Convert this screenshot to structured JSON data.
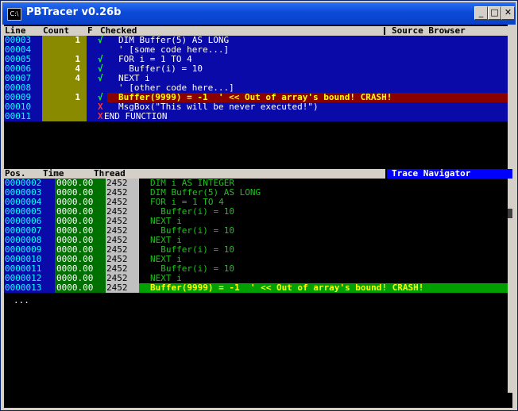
{
  "window": {
    "title": "PBTracer v0.26b",
    "icon_label": "C:\\",
    "controls": {
      "minimize": "_",
      "maximize": "□",
      "close": "✕"
    }
  },
  "colors": {
    "code_bg": "#0a0aa8",
    "count_bg": "#8a8a00",
    "line_fg": "#00ffff",
    "code_fg": "#ffffff",
    "check_ok": "#00ff00",
    "check_fail": "#ff3030",
    "crash_bg": "#8a0000",
    "crash_fg": "#ffff00",
    "trace_fg": "#20c020",
    "trace_hl_bg": "#00a000",
    "trace_hl_fg": "#ffff00"
  },
  "source": {
    "headers": {
      "line": "Line",
      "count": "Count",
      "flag": "F",
      "checked": "Checked"
    },
    "browser_title": "Source Browser",
    "rows": [
      {
        "line": "00003",
        "count": "1",
        "mark": "√",
        "code": "DIM Buffer(5) AS LONG"
      },
      {
        "line": "00004",
        "count": "",
        "mark": "",
        "code": "' [some code here...]"
      },
      {
        "line": "00005",
        "count": "1",
        "mark": "√",
        "code": "FOR i = 1 TO 4"
      },
      {
        "line": "00006",
        "count": "4",
        "mark": "√",
        "code": "  Buffer(i) = 10"
      },
      {
        "line": "00007",
        "count": "4",
        "mark": "√",
        "code": "NEXT i"
      },
      {
        "line": "00008",
        "count": "",
        "mark": "",
        "code": "' [other code here...]"
      },
      {
        "line": "00009",
        "count": "1",
        "mark": "√",
        "code": "Buffer(9999) = -1  ' << Out of array's bound! CRASH!"
      },
      {
        "line": "00010",
        "count": "",
        "mark": "X",
        "code": "MsgBox(\"This will be never executed!\")"
      },
      {
        "line": "00011",
        "count": "",
        "mark": "X",
        "code": "END FUNCTION"
      }
    ]
  },
  "trace": {
    "headers": {
      "pos": "Pos.",
      "time": "Time",
      "thread": "Thread"
    },
    "navigator_title": "Trace Navigator",
    "rows": [
      {
        "pos": "0000002",
        "time": "0000.00",
        "thread": "2452",
        "code": "DIM i AS INTEGER"
      },
      {
        "pos": "0000003",
        "time": "0000.00",
        "thread": "2452",
        "code": "DIM Buffer(5) AS LONG"
      },
      {
        "pos": "0000004",
        "time": "0000.00",
        "thread": "2452",
        "code": "FOR i = 1 TO 4"
      },
      {
        "pos": "0000005",
        "time": "0000.00",
        "thread": "2452",
        "code": "  Buffer(i) = 10"
      },
      {
        "pos": "0000006",
        "time": "0000.00",
        "thread": "2452",
        "code": "NEXT i"
      },
      {
        "pos": "0000007",
        "time": "0000.00",
        "thread": "2452",
        "code": "  Buffer(i) = 10"
      },
      {
        "pos": "0000008",
        "time": "0000.00",
        "thread": "2452",
        "code": "NEXT i"
      },
      {
        "pos": "0000009",
        "time": "0000.00",
        "thread": "2452",
        "code": "  Buffer(i) = 10"
      },
      {
        "pos": "0000010",
        "time": "0000.00",
        "thread": "2452",
        "code": "NEXT i"
      },
      {
        "pos": "0000011",
        "time": "0000.00",
        "thread": "2452",
        "code": "  Buffer(i) = 10"
      },
      {
        "pos": "0000012",
        "time": "0000.00",
        "thread": "2452",
        "code": "NEXT i"
      },
      {
        "pos": "0000013",
        "time": "0000.00",
        "thread": "2452",
        "code": "Buffer(9999) = -1  ' << Out of array's bound! CRASH!"
      }
    ],
    "ellipsis": "..."
  }
}
